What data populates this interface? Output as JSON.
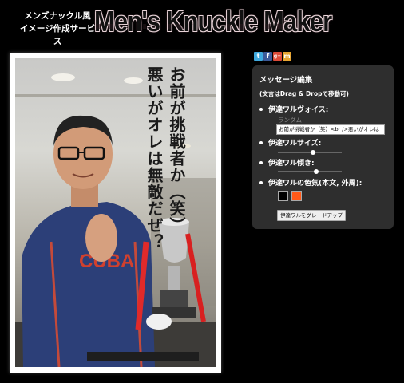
{
  "header": {
    "tagline_line1": "メンズナックル風",
    "tagline_line2": "イメージ作成サービス",
    "logo_text": "Men's Knuckle Maker"
  },
  "photo": {
    "overlay_line1": "お前が挑戦者か（笑）",
    "overlay_line2": "悪いがオレは無敵だぜ？",
    "shirt_letters": "CUBA"
  },
  "social": {
    "icons": [
      "twitter-icon",
      "facebook-icon",
      "google-plus-icon",
      "mixi-icon"
    ],
    "labels": [
      "t",
      "f",
      "g+",
      "m"
    ],
    "colors": [
      "#3fa9de",
      "#3b5998",
      "#dd4b39",
      "#e8a531"
    ]
  },
  "panel": {
    "title": "メッセージ編集",
    "hint": "(文言はDrag & Dropで移動可)",
    "voice_label": "伊達ワルヴォイス:",
    "voice_sub": "ランダム",
    "voice_value": "お前が挑戦者か（笑）<br />悪いがオレは",
    "size_label": "伊達ワルサイズ:",
    "size_level": 0.55,
    "tilt_label": "伊達ワル傾き:",
    "tilt_level": 0.6,
    "color_label": "伊達ワルの色気(本文, 外周):",
    "color_main": "#000000",
    "color_outer": "#ff5a1a",
    "upgrade_button": "伊達ワルをグレードアップ"
  }
}
